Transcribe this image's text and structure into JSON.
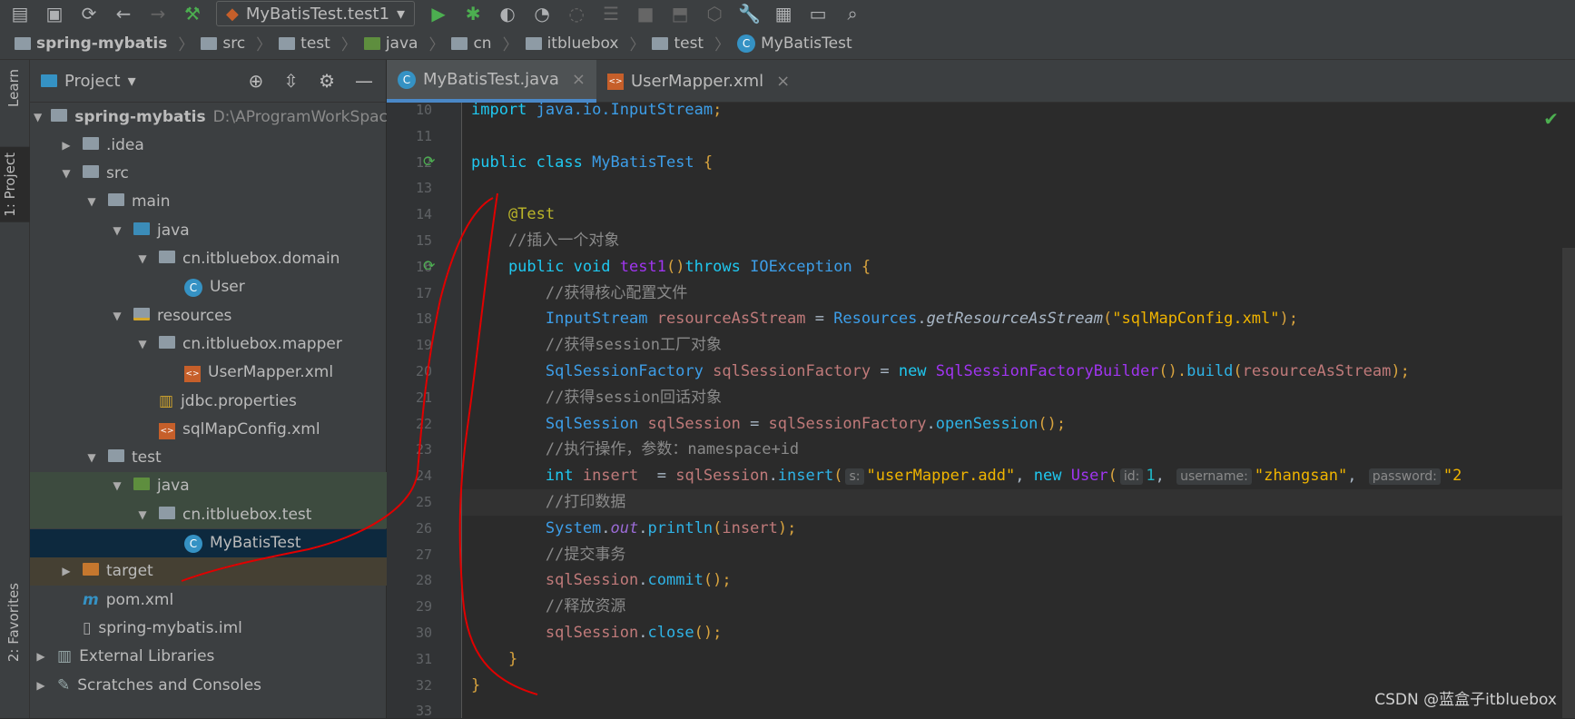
{
  "toolbar": {
    "run_config": "MyBatisTest.test1",
    "icons": [
      "open-icon",
      "save-icon",
      "sync-icon",
      "back-icon",
      "forward-icon",
      "build-icon",
      "run-icon",
      "debug-icon",
      "coverage-icon",
      "profile-icon",
      "attach-icon",
      "step-icon",
      "stop-icon",
      "deploy-icon",
      "structure-icon",
      "settings-icon",
      "project-structure-icon",
      "terminal-icon",
      "search-icon"
    ]
  },
  "breadcrumb": [
    "spring-mybatis",
    "src",
    "test",
    "java",
    "cn",
    "itbluebox",
    "test",
    "MyBatisTest"
  ],
  "sidebar_stripe": {
    "learn": "Learn",
    "project": "1: Project",
    "favorites": "2: Favorites"
  },
  "project": {
    "title": "Project",
    "tree": [
      {
        "label": "spring-mybatis",
        "path": "D:\\AProgramWorkSpace",
        "depth": 0,
        "arrow": "▼",
        "icon": "module"
      },
      {
        "label": ".idea",
        "depth": 1,
        "arrow": "▶",
        "icon": "folder"
      },
      {
        "label": "src",
        "depth": 1,
        "arrow": "▼",
        "icon": "folder"
      },
      {
        "label": "main",
        "depth": 2,
        "arrow": "▼",
        "icon": "folder"
      },
      {
        "label": "java",
        "depth": 3,
        "arrow": "▼",
        "icon": "folder-blue"
      },
      {
        "label": "cn.itbluebox.domain",
        "depth": 4,
        "arrow": "▼",
        "icon": "package"
      },
      {
        "label": "User",
        "depth": 5,
        "arrow": "",
        "icon": "class"
      },
      {
        "label": "resources",
        "depth": 3,
        "arrow": "▼",
        "icon": "resources"
      },
      {
        "label": "cn.itbluebox.mapper",
        "depth": 4,
        "arrow": "▼",
        "icon": "package"
      },
      {
        "label": "UserMapper.xml",
        "depth": 5,
        "arrow": "",
        "icon": "xml"
      },
      {
        "label": "jdbc.properties",
        "depth": 4,
        "arrow": "",
        "icon": "properties"
      },
      {
        "label": "sqlMapConfig.xml",
        "depth": 4,
        "arrow": "",
        "icon": "xml"
      },
      {
        "label": "test",
        "depth": 2,
        "arrow": "▼",
        "icon": "folder"
      },
      {
        "label": "java",
        "depth": 3,
        "arrow": "▼",
        "icon": "folder-green"
      },
      {
        "label": "cn.itbluebox.test",
        "depth": 4,
        "arrow": "▼",
        "icon": "package"
      },
      {
        "label": "MyBatisTest",
        "depth": 5,
        "arrow": "",
        "icon": "class"
      },
      {
        "label": "target",
        "depth": 1,
        "arrow": "▶",
        "icon": "folder-orange"
      },
      {
        "label": "pom.xml",
        "depth": 1,
        "arrow": "",
        "icon": "maven"
      },
      {
        "label": "spring-mybatis.iml",
        "depth": 1,
        "arrow": "",
        "icon": "iml"
      },
      {
        "label": "External Libraries",
        "depth": 0,
        "arrow": "▶",
        "icon": "libraries"
      },
      {
        "label": "Scratches and Consoles",
        "depth": 0,
        "arrow": "▶",
        "icon": "scratches"
      }
    ]
  },
  "tabs": [
    {
      "label": "MyBatisTest.java",
      "active": true
    },
    {
      "label": "UserMapper.xml",
      "active": false
    }
  ],
  "editor": {
    "current_line": 25,
    "lines": [
      {
        "n": 10,
        "tokens": [
          [
            "import ",
            "kw"
          ],
          [
            "java.io.InputStream",
            "ty"
          ],
          [
            ";",
            "pn"
          ]
        ]
      },
      {
        "n": 11,
        "tokens": []
      },
      {
        "n": 12,
        "run": true,
        "tokens": [
          [
            "public class ",
            "kw"
          ],
          [
            "MyBatisTest ",
            "ty"
          ],
          [
            "{",
            "pn"
          ]
        ]
      },
      {
        "n": 13,
        "tokens": []
      },
      {
        "n": 14,
        "tokens": [
          [
            "    @Test",
            "an"
          ]
        ]
      },
      {
        "n": 15,
        "tokens": [
          [
            "    //插入一个对象",
            "cm"
          ]
        ]
      },
      {
        "n": 16,
        "run": true,
        "tokens": [
          [
            "    public void ",
            "kw"
          ],
          [
            "test1",
            "nw"
          ],
          [
            "()",
            "pn"
          ],
          [
            "throws ",
            "kw"
          ],
          [
            "IOException ",
            "ty"
          ],
          [
            "{",
            "pn"
          ]
        ]
      },
      {
        "n": 17,
        "tokens": [
          [
            "        //获得核心配置文件",
            "cm"
          ]
        ]
      },
      {
        "n": 18,
        "tokens": [
          [
            "        InputStream ",
            "ty"
          ],
          [
            "resourceAsStream ",
            "vr"
          ],
          [
            "= ",
            "tx"
          ],
          [
            "Resources",
            "ty"
          ],
          [
            ".",
            "tx"
          ],
          [
            "getResourceAsStream",
            "mi"
          ],
          [
            "(",
            "pn"
          ],
          [
            "\"sqlMapConfig.xml\"",
            "st"
          ],
          [
            ");",
            "pn"
          ]
        ]
      },
      {
        "n": 19,
        "tokens": [
          [
            "        //获得session工厂对象",
            "cm"
          ]
        ]
      },
      {
        "n": 20,
        "tokens": [
          [
            "        SqlSessionFactory ",
            "ty"
          ],
          [
            "sqlSessionFactory ",
            "vr"
          ],
          [
            "= ",
            "tx"
          ],
          [
            "new ",
            "kw"
          ],
          [
            "SqlSessionFactoryBuilder",
            "nw"
          ],
          [
            "().",
            "pn"
          ],
          [
            "build",
            "me"
          ],
          [
            "(",
            "pn"
          ],
          [
            "resourceAsStream",
            "vr"
          ],
          [
            ");",
            "pn"
          ]
        ]
      },
      {
        "n": 21,
        "tokens": [
          [
            "        //获得session回话对象",
            "cm"
          ]
        ]
      },
      {
        "n": 22,
        "tokens": [
          [
            "        SqlSession ",
            "ty"
          ],
          [
            "sqlSession ",
            "vr"
          ],
          [
            "= ",
            "tx"
          ],
          [
            "sqlSessionFactory",
            "vr"
          ],
          [
            ".",
            "tx"
          ],
          [
            "openSession",
            "me"
          ],
          [
            "();",
            "pn"
          ]
        ]
      },
      {
        "n": 23,
        "tokens": [
          [
            "        //执行操作，参数：namespace+id",
            "cm"
          ]
        ]
      },
      {
        "n": 24,
        "tokens": [
          [
            "        int ",
            "kw"
          ],
          [
            "insert  ",
            "vr"
          ],
          [
            "= ",
            "tx"
          ],
          [
            "sqlSession",
            "vr"
          ],
          [
            ".",
            "tx"
          ],
          [
            "insert",
            "me"
          ],
          [
            "(",
            "pn"
          ],
          [
            "s:",
            "hint"
          ],
          [
            "\"userMapper.add\"",
            "st"
          ],
          [
            ", ",
            "tx"
          ],
          [
            "new ",
            "kw"
          ],
          [
            "User",
            "nw"
          ],
          [
            "(",
            "pn"
          ],
          [
            "id:",
            "hint"
          ],
          [
            "1",
            "nu"
          ],
          [
            ", ",
            "tx"
          ],
          [
            "username:",
            "hint"
          ],
          [
            "\"zhangsan\"",
            "st"
          ],
          [
            ", ",
            "tx"
          ],
          [
            "password:",
            "hint"
          ],
          [
            "\"2",
            "st"
          ]
        ]
      },
      {
        "n": 25,
        "tokens": [
          [
            "        //打印数据",
            "cm"
          ]
        ]
      },
      {
        "n": 26,
        "tokens": [
          [
            "        System",
            "ty"
          ],
          [
            ".",
            "tx"
          ],
          [
            "out",
            "it"
          ],
          [
            ".",
            "tx"
          ],
          [
            "println",
            "me"
          ],
          [
            "(",
            "pn"
          ],
          [
            "insert",
            "vr"
          ],
          [
            ");",
            "pn"
          ]
        ]
      },
      {
        "n": 27,
        "tokens": [
          [
            "        //提交事务",
            "cm"
          ]
        ]
      },
      {
        "n": 28,
        "tokens": [
          [
            "        sqlSession",
            "vr"
          ],
          [
            ".",
            "tx"
          ],
          [
            "commit",
            "me"
          ],
          [
            "();",
            "pn"
          ]
        ]
      },
      {
        "n": 29,
        "tokens": [
          [
            "        //释放资源",
            "cm"
          ]
        ]
      },
      {
        "n": 30,
        "tokens": [
          [
            "        sqlSession",
            "vr"
          ],
          [
            ".",
            "tx"
          ],
          [
            "close",
            "me"
          ],
          [
            "();",
            "pn"
          ]
        ]
      },
      {
        "n": 31,
        "tokens": [
          [
            "    }",
            "pn"
          ]
        ]
      },
      {
        "n": 32,
        "tokens": [
          [
            "}",
            "pn"
          ]
        ]
      },
      {
        "n": 33,
        "tokens": []
      }
    ]
  },
  "watermark": "CSDN @蓝盒子itbluebox",
  "colors": {
    "annotation_stroke": "#e00000",
    "accent": "#4a88c7"
  }
}
